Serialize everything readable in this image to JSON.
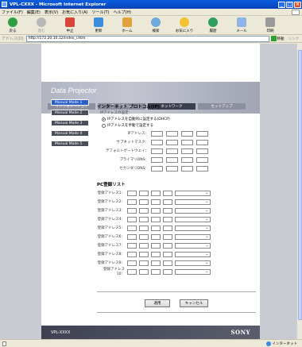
{
  "window": {
    "title": "VPL-CXXX - Microsoft Internet Explorer",
    "minimize": "_",
    "maximize": "□",
    "close": "×"
  },
  "menu": [
    "ファイル(F)",
    "編集(E)",
    "表示(V)",
    "お気に入り(A)",
    "ツール(T)",
    "ヘルプ(H)"
  ],
  "toolbar": {
    "back": "戻る",
    "forward": "進む",
    "stop": "中止",
    "refresh": "更新",
    "home": "ホーム",
    "search": "検索",
    "favorites": "お気に入り",
    "history": "履歴",
    "mail": "メール",
    "print": "印刷"
  },
  "address": {
    "label": "アドレス(D)",
    "url": "http://172.20.10.12/index_i.htm",
    "go": "移動",
    "links": "リンク"
  },
  "banner": {
    "brand": "Data Projector",
    "tabs": [
      "インフォメーション",
      "コントロール",
      "ネットワーク",
      "セットアップ"
    ]
  },
  "sidemenu": [
    "Manual Mode 1",
    "Manual Mode 2",
    "Manual Mode 3",
    "Manual Mode 4",
    "Manual Mode 5"
  ],
  "ip": {
    "title": "インターネット プロトコル(IP)",
    "subtitle": "IPアドレスの設定：",
    "option_dhcp": "IPアドレスを自動的に設定する(DHCP)",
    "option_manual": "IPアドレスを手動で設定する",
    "fields": [
      "IPアドレス：",
      "サブネットマスク：",
      "デフォルトゲートウェイ：",
      "プライマリDNS：",
      "セカンダリDNS："
    ]
  },
  "pc": {
    "title": "PC登録リスト",
    "rows": [
      "登録アドレス1：",
      "登録アドレス2：",
      "登録アドレス3：",
      "登録アドレス4：",
      "登録アドレス5：",
      "登録アドレス6：",
      "登録アドレス7：",
      "登録アドレス8：",
      "登録アドレス9：",
      "登録アドレス10："
    ]
  },
  "buttons": {
    "apply": "適用",
    "cancel": "キャンセル"
  },
  "footer": {
    "model": "VPL-XXXX",
    "brand": "SONY"
  },
  "status": {
    "zone": "インターネット"
  }
}
